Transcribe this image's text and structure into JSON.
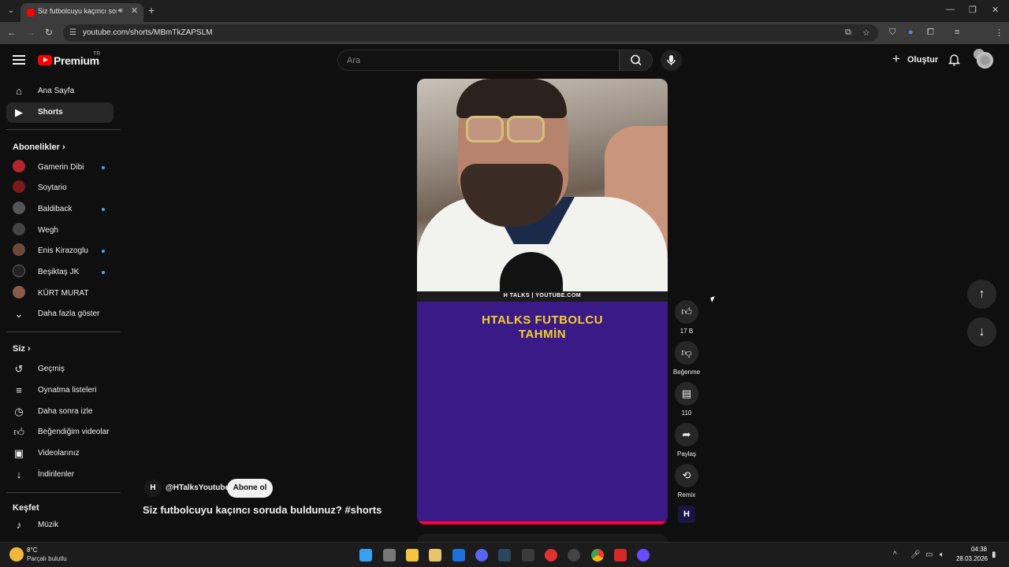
{
  "browser": {
    "tab_title": "Siz futbolcuyu kaçıncı soruda",
    "url": "youtube.com/shorts/MBmTkZAPSLM"
  },
  "header": {
    "logo_text": "Premium",
    "country_code": "TR",
    "search_placeholder": "Ara",
    "create_label": "Oluştur"
  },
  "sidebar": {
    "main": [
      {
        "label": "Ana Sayfa",
        "icon": "home-icon"
      },
      {
        "label": "Shorts",
        "icon": "shorts-icon",
        "active": true
      }
    ],
    "subscriptions_title": "Abonelikler",
    "subscriptions": [
      {
        "label": "Gamerin Dibi",
        "dot": true,
        "color": "#b3262e"
      },
      {
        "label": "Soytario",
        "dot": false,
        "color": "#7a1a1a"
      },
      {
        "label": "Baldiback",
        "dot": true,
        "color": "#555555"
      },
      {
        "label": "Wegh",
        "dot": false,
        "color": "#444444"
      },
      {
        "label": "Enis Kirazoglu",
        "dot": true,
        "color": "#6b4a3a"
      },
      {
        "label": "Beşiktaş JK",
        "dot": true,
        "color": "#222222"
      },
      {
        "label": "KÜRT MURAT",
        "dot": false,
        "color": "#8a5a4a"
      }
    ],
    "show_more_label": "Daha fazla göster",
    "you_title": "Siz",
    "you_items": [
      {
        "label": "Geçmiş",
        "icon": "history-icon"
      },
      {
        "label": "Oynatma listeleri",
        "icon": "playlists-icon"
      },
      {
        "label": "Daha sonra izle",
        "icon": "watch-later-icon"
      },
      {
        "label": "Beğendiğim videolar",
        "icon": "liked-icon"
      },
      {
        "label": "Videolarınız",
        "icon": "your-videos-icon"
      },
      {
        "label": "İndirilenler",
        "icon": "downloads-icon"
      }
    ],
    "explore_title": "Keşfet",
    "explore_items": [
      {
        "label": "Müzik",
        "icon": "music-icon"
      }
    ]
  },
  "video": {
    "banner_text": "H TALKS | YOUTUBE.COM",
    "title_line1": "HTALKS FUTBOLCU",
    "title_line2": "TAHMİN",
    "title_color": "#f2d22a",
    "bg_color": "#3a1a86"
  },
  "actions": {
    "like_count": "17 B",
    "dislike_label": "Beğenme",
    "comment_count": "110",
    "share_label": "Paylaş",
    "remix_label": "Remix"
  },
  "channel": {
    "handle": "@HTalksYoutube",
    "subscribe_label": "Abone ol",
    "short_title": "Siz futbolcuyu kaçıncı soruda buldunuz? #shorts"
  },
  "taskbar": {
    "temperature": "8°C",
    "condition": "Parçalı bulutlu",
    "time": "04:38",
    "date": "28.03.2026"
  }
}
